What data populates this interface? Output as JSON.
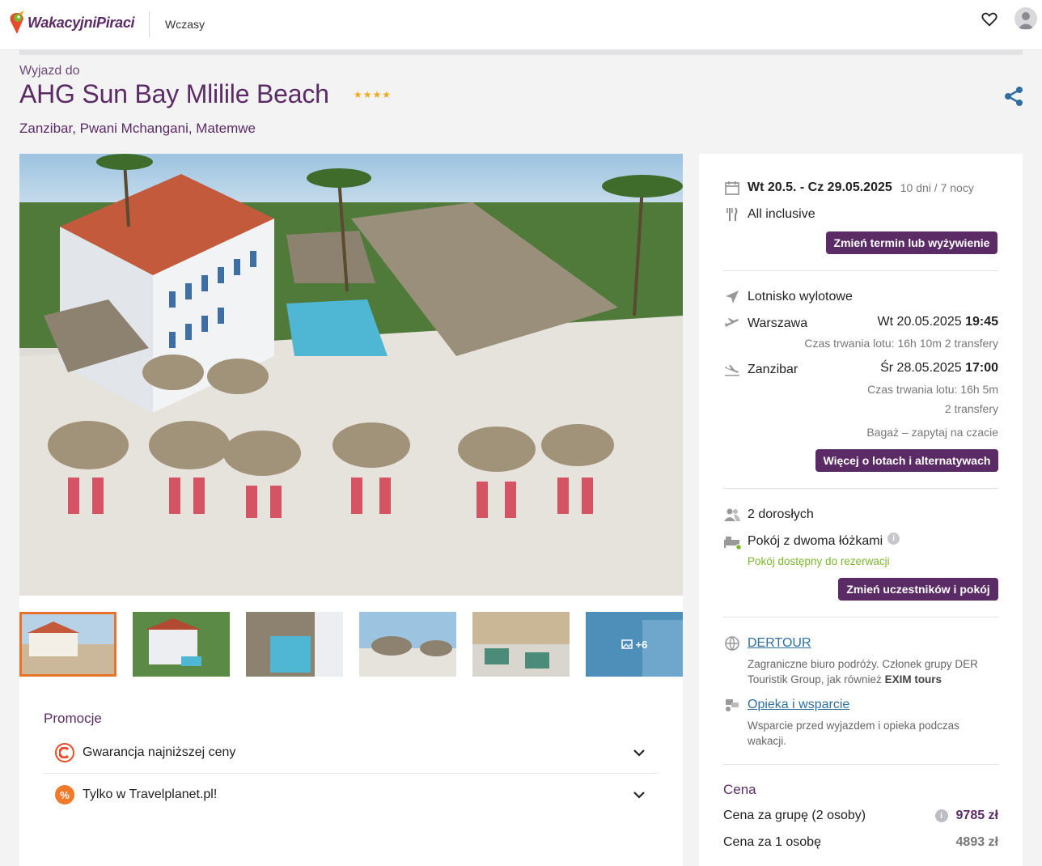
{
  "header": {
    "logo_text": "WakacyjniPiraci",
    "nav_label": "Wczasy",
    "favorites_icon": "heart-icon",
    "account_icon": "user-avatar-icon"
  },
  "title": {
    "trip_to": "Wyjazd do",
    "hotel_name": "AHG Sun Bay Mlilile Beach",
    "stars": "★★★★",
    "location": "Zanzibar, Pwani Mchangani, Matemwe"
  },
  "gallery": {
    "more_count": "+6"
  },
  "promotions": {
    "title": "Promocje",
    "items": [
      {
        "label": "Gwarancja najniższej ceny"
      },
      {
        "label": "Tylko w Travelplanet.pl!"
      }
    ]
  },
  "booking": {
    "dates": "Wt 20.5. - Cz 29.05.2025",
    "duration": "10 dni / 7 nocy",
    "board": "All inclusive",
    "change_term_button": "Zmień termin lub wyżywienie",
    "airport_label": "Lotnisko wylotowe",
    "outbound": {
      "city": "Warszawa",
      "date": "Wt 20.05.2025",
      "time": "19:45",
      "info": "Czas trwania lotu: 16h 10m  2 transfery"
    },
    "inbound": {
      "city": "Zanzibar",
      "date": "Śr 28.05.2025",
      "time": "17:00",
      "info": "Czas trwania lotu: 16h 5m",
      "transfers": "2 transfery"
    },
    "baggage": "Bagaż – zapytaj na czacie",
    "flights_button": "Więcej o lotach i alternatywach",
    "travellers": "2 dorosłych",
    "room": "Pokój z dwoma łóżkami",
    "room_status": "Pokój dostępny do rezerwacji",
    "change_room_button": "Zmień uczestników i pokój",
    "operator": {
      "name": "DERTOUR",
      "desc_a": "Zagraniczne biuro podróży. Członek grupy DER Touristik Group, jak również ",
      "desc_b": "EXIM tours"
    },
    "support": {
      "name": "Opieka i wsparcie",
      "desc": "Wsparcie przed wyjazdem i opieka podczas wakacji."
    },
    "price": {
      "title": "Cena",
      "group_label": "Cena za grupę (2 osoby)",
      "group_value": "9785 zł",
      "person_label": "Cena za 1 osobę",
      "person_value": "4893 zł"
    }
  },
  "colors": {
    "brand": "#5b2b66",
    "accent_orange": "#e8732b",
    "link": "#2f6f9f",
    "available": "#7bb52e"
  }
}
